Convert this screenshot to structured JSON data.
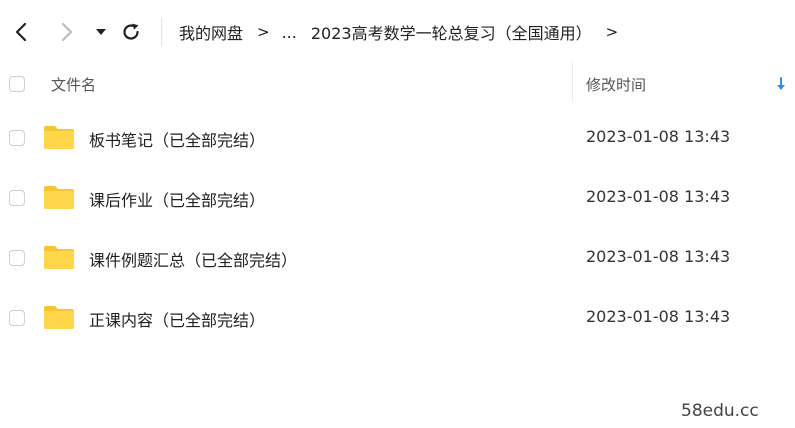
{
  "toolbar": {
    "breadcrumbs": [
      "我的网盘",
      "...",
      "2023高考数学一轮总复习（全国通用）"
    ],
    "separator": ">"
  },
  "table": {
    "headers": {
      "name": "文件名",
      "modified": "修改时间"
    },
    "rows": [
      {
        "name": "板书笔记（已全部完结）",
        "modified": "2023-01-08 13:43"
      },
      {
        "name": "课后作业（已全部完结）",
        "modified": "2023-01-08 13:43"
      },
      {
        "name": "课件例题汇总（已全部完结）",
        "modified": "2023-01-08 13:43"
      },
      {
        "name": "正课内容（已全部完结）",
        "modified": "2023-01-08 13:43"
      }
    ]
  },
  "watermark": "58edu.cc",
  "colors": {
    "folder": "#FFD54A",
    "folder_tab": "#F5C533",
    "sort_arrow": "#2f8cf0",
    "checkbox_border": "#cfcfcf"
  },
  "icons": [
    "back-icon",
    "forward-icon",
    "dropdown-icon",
    "refresh-icon",
    "folder-icon",
    "sort-down-arrow-icon"
  ]
}
